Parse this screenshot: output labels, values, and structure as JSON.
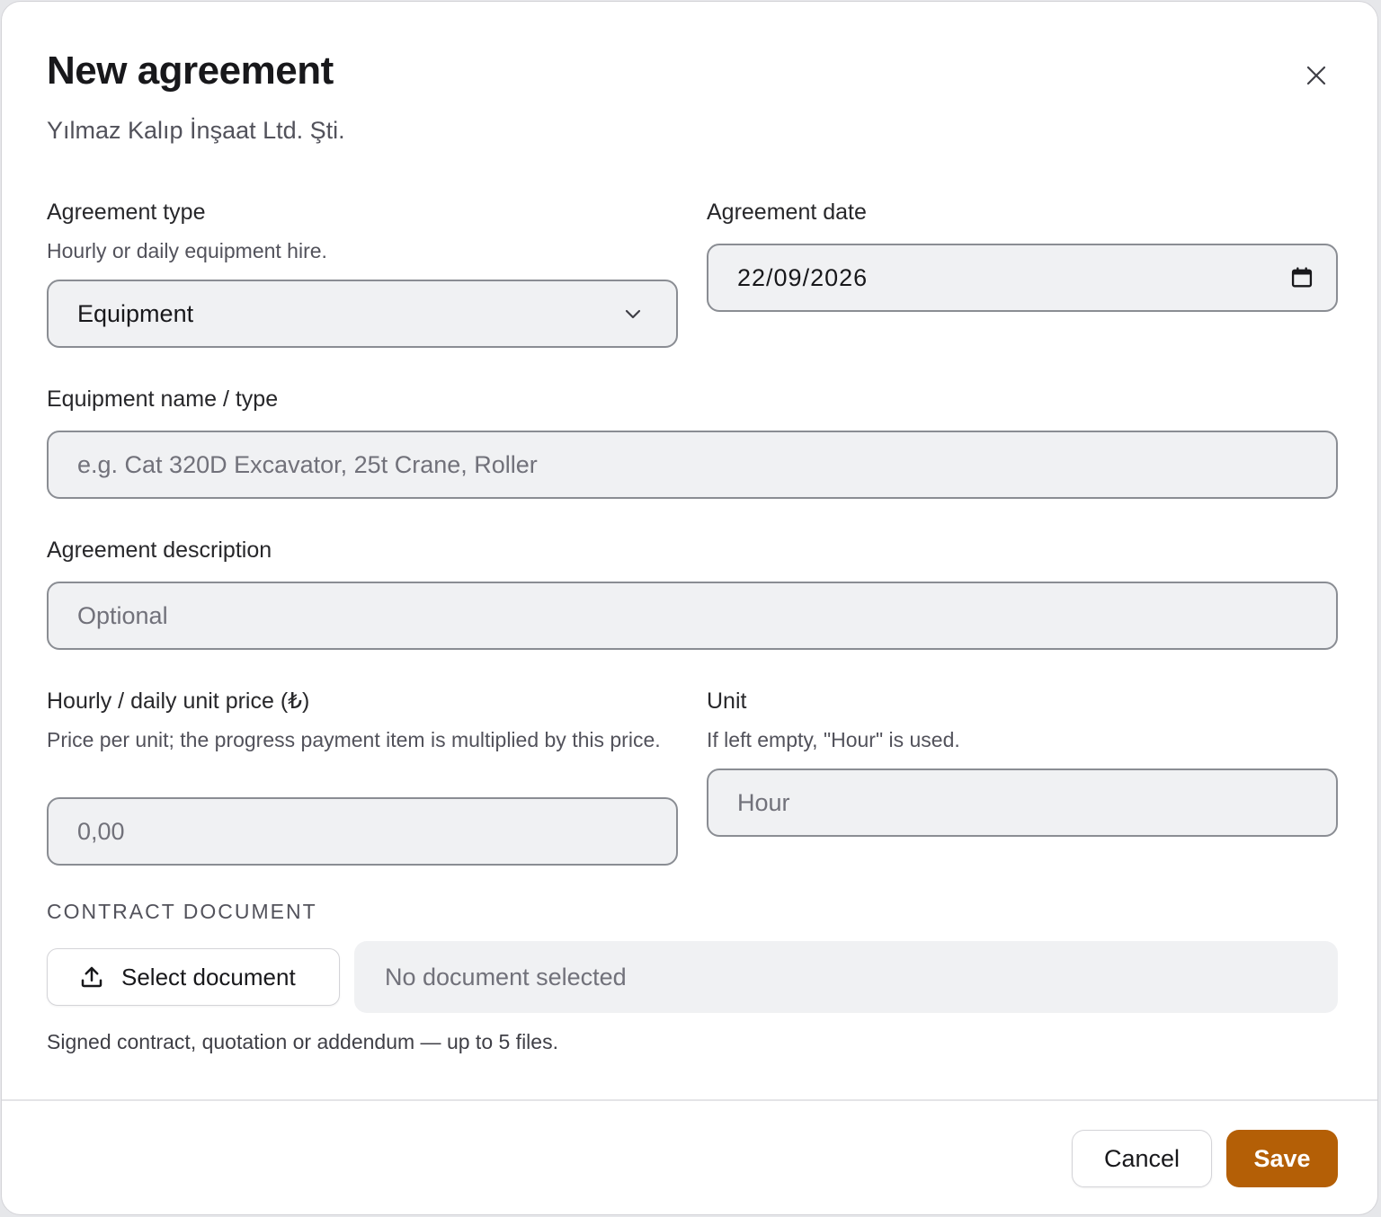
{
  "dialog": {
    "title": "New agreement",
    "subtitle": "Yılmaz Kalıp İnşaat Ltd. Şti."
  },
  "agreement_type": {
    "label": "Agreement type",
    "hint": "Hourly or daily equipment hire.",
    "value": "Equipment"
  },
  "agreement_date": {
    "label": "Agreement date",
    "value": "22/09/2026"
  },
  "equipment_name": {
    "label": "Equipment name / type",
    "placeholder": "e.g. Cat 320D Excavator, 25t Crane, Roller"
  },
  "description": {
    "label": "Agreement description",
    "placeholder": "Optional"
  },
  "unit_price": {
    "label": "Hourly / daily unit price (₺)",
    "hint": "Price per unit; the progress payment item is multiplied by this price.",
    "placeholder": "0,00"
  },
  "unit": {
    "label": "Unit",
    "hint": "If left empty, \"Hour\" is used.",
    "placeholder": "Hour"
  },
  "contract_document": {
    "heading": "CONTRACT DOCUMENT",
    "button_label": "Select document",
    "status": "No document selected",
    "hint": "Signed contract, quotation or addendum — up to 5 files."
  },
  "footer": {
    "cancel_label": "Cancel",
    "save_label": "Save"
  },
  "colors": {
    "accent": "#b45f06",
    "field_bg": "#f0f1f3",
    "field_border": "#8a8d93"
  },
  "icons": {
    "close": "close-icon",
    "select_chevron": "chevron-down-icon",
    "date": "calendar-icon",
    "upload": "upload-icon"
  }
}
